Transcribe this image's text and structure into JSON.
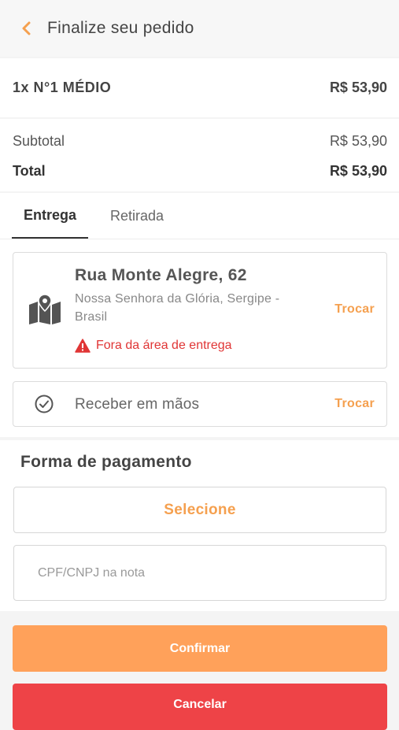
{
  "header": {
    "title": "Finalize seu pedido",
    "back_icon": "chevron-left-icon"
  },
  "order": {
    "item": "1x N°1 MÉDIO",
    "price": "R$ 53,90"
  },
  "totals": {
    "subtotal_label": "Subtotal",
    "subtotal_value": "R$ 53,90",
    "total_label": "Total",
    "total_value": "R$ 53,90"
  },
  "tabs": [
    {
      "label": "Entrega",
      "active": true
    },
    {
      "label": "Retirada",
      "active": false
    }
  ],
  "address": {
    "street": "Rua Monte Alegre, 62",
    "city": "Nossa Senhora da Glória, Sergipe - Brasil",
    "warning": "Fora da área de entrega",
    "change_label": "Trocar",
    "icon": "map-icon"
  },
  "receive": {
    "label": "Receber em mãos",
    "change_label": "Trocar",
    "icon": "check-circle-icon"
  },
  "payment": {
    "title": "Forma de pagamento",
    "select_label": "Selecione",
    "cpf_placeholder": "CPF/CNPJ na nota",
    "cpf_value": ""
  },
  "actions": {
    "confirm_label": "Confirmar",
    "cancel_label": "Cancelar"
  },
  "colors": {
    "accent": "#f5a04f",
    "confirm": "#ffa15a",
    "cancel": "#ee4347",
    "warning": "#e03535"
  }
}
